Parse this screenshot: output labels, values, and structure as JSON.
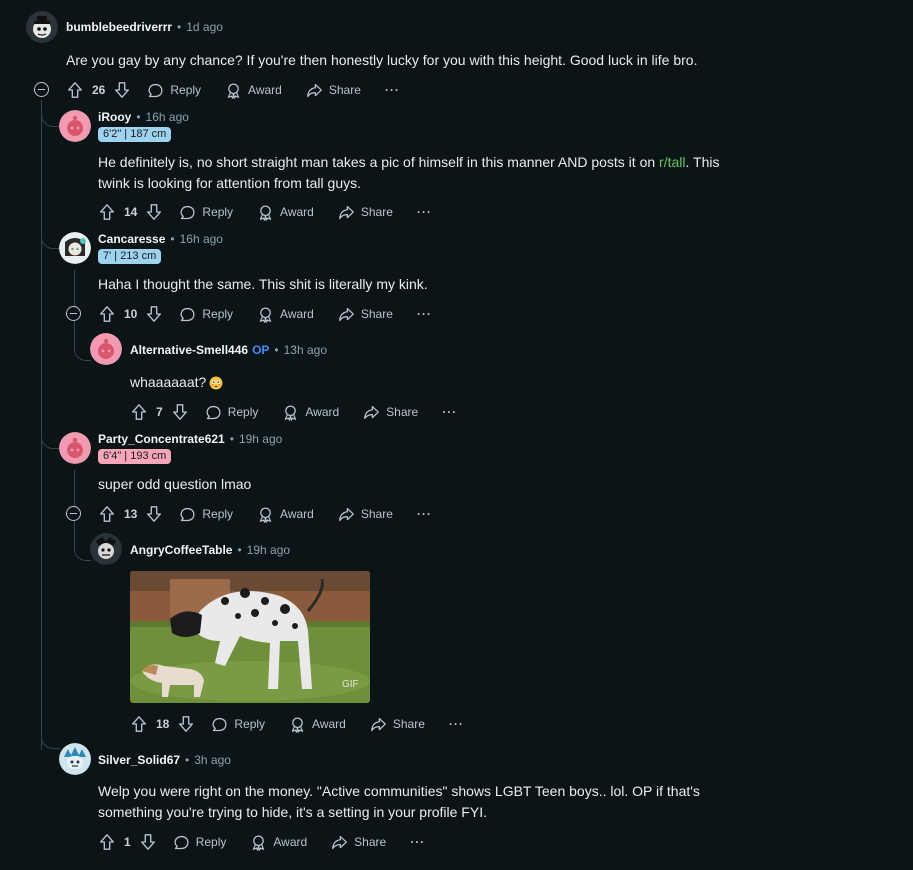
{
  "comments": [
    {
      "username": "bumblebeedriverrr",
      "time": "1d ago",
      "text": "Are you gay by any chance? If you're then honestly lucky for you with this height. Good luck in life bro.",
      "votes": "26",
      "actions": {
        "reply": "Reply",
        "award": "Award",
        "share": "Share",
        "more": "···"
      }
    },
    {
      "username": "iRooy",
      "time": "16h ago",
      "flair": "6'2\" | 187 cm",
      "flair_color": "#9ed3f0",
      "text_before": "He definitely is, no short straight man takes a pic of himself in this manner AND posts it on ",
      "link": "r/tall",
      "text_after": ". This twink is looking for attention from tall guys.",
      "votes": "14",
      "actions": {
        "reply": "Reply",
        "award": "Award",
        "share": "Share",
        "more": "···"
      }
    },
    {
      "username": "Cancaresse",
      "time": "16h ago",
      "flair": "7' | 213 cm",
      "flair_color": "#9ed3f0",
      "text": "Haha I thought the same. This shit is literally my kink.",
      "votes": "10",
      "actions": {
        "reply": "Reply",
        "award": "Award",
        "share": "Share",
        "more": "···"
      }
    },
    {
      "username": "Alternative-Smell446",
      "op_badge": "OP",
      "time": "13h ago",
      "text": "whaaaaaat?",
      "votes": "7",
      "actions": {
        "reply": "Reply",
        "award": "Award",
        "share": "Share",
        "more": "···"
      }
    },
    {
      "username": "Party_Concentrate621",
      "time": "19h ago",
      "flair": "6'4\" | 193 cm",
      "flair_color": "#f7a6ba",
      "text": "super odd question lmao",
      "votes": "13",
      "actions": {
        "reply": "Reply",
        "award": "Award",
        "share": "Share",
        "more": "···"
      }
    },
    {
      "username": "AngryCoffeeTable",
      "time": "19h ago",
      "gif_badge": "GIF",
      "votes": "18",
      "actions": {
        "reply": "Reply",
        "award": "Award",
        "share": "Share",
        "more": "···"
      }
    },
    {
      "username": "Silver_Solid67",
      "time": "3h ago",
      "text": "Welp you were right on the money. \"Active communities\" shows LGBT Teen boys.. lol. OP if that's something you're trying to hide, it's a setting in your profile FYI.",
      "votes": "1",
      "actions": {
        "reply": "Reply",
        "award": "Award",
        "share": "Share",
        "more": "···"
      }
    }
  ],
  "icons": {
    "upvote": "upvote-icon",
    "downvote": "downvote-icon",
    "reply": "reply-bubble-icon",
    "award": "award-icon",
    "share": "share-icon",
    "collapse": "collapse-minus-icon",
    "flushed_emoji": "flushed-face-emoji"
  },
  "colors": {
    "background": "#0b1416",
    "thread_line": "#33464c",
    "link": "#62c55d",
    "op": "#3e8ef7"
  }
}
